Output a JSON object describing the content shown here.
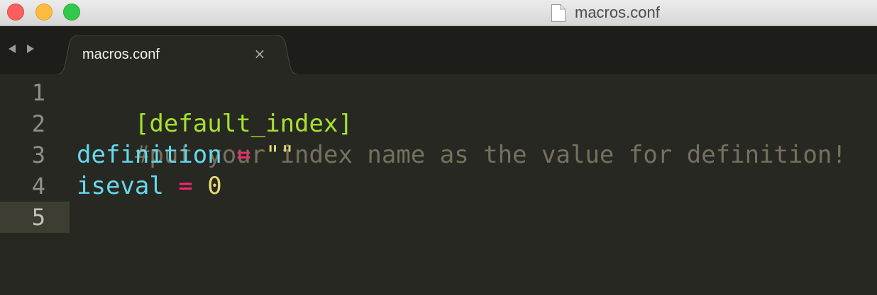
{
  "window": {
    "title": "macros.conf"
  },
  "tabs": [
    {
      "label": "macros.conf",
      "close_glyph": "×",
      "active": true
    }
  ],
  "colors": {
    "background": "#272822",
    "section": "#a6e22e",
    "comment": "#75715e",
    "key": "#66d9ef",
    "operator": "#f92672",
    "string": "#e6db74"
  },
  "icons": {
    "document": "document-icon",
    "back": "back-arrow-icon",
    "forward": "forward-arrow-icon",
    "close": "close-icon"
  },
  "editor": {
    "current_line": 5,
    "line_numbers": [
      "1",
      "2",
      "3",
      "4",
      "5"
    ],
    "lines": [
      {
        "section": "[default_index]"
      },
      {
        "comment": "#put your index name as the value for definition!"
      },
      {
        "key": "definition",
        "op": "=",
        "value": "\"\""
      },
      {
        "key": "iseval",
        "op": "=",
        "value": "0"
      },
      {
        "text": ""
      }
    ]
  }
}
